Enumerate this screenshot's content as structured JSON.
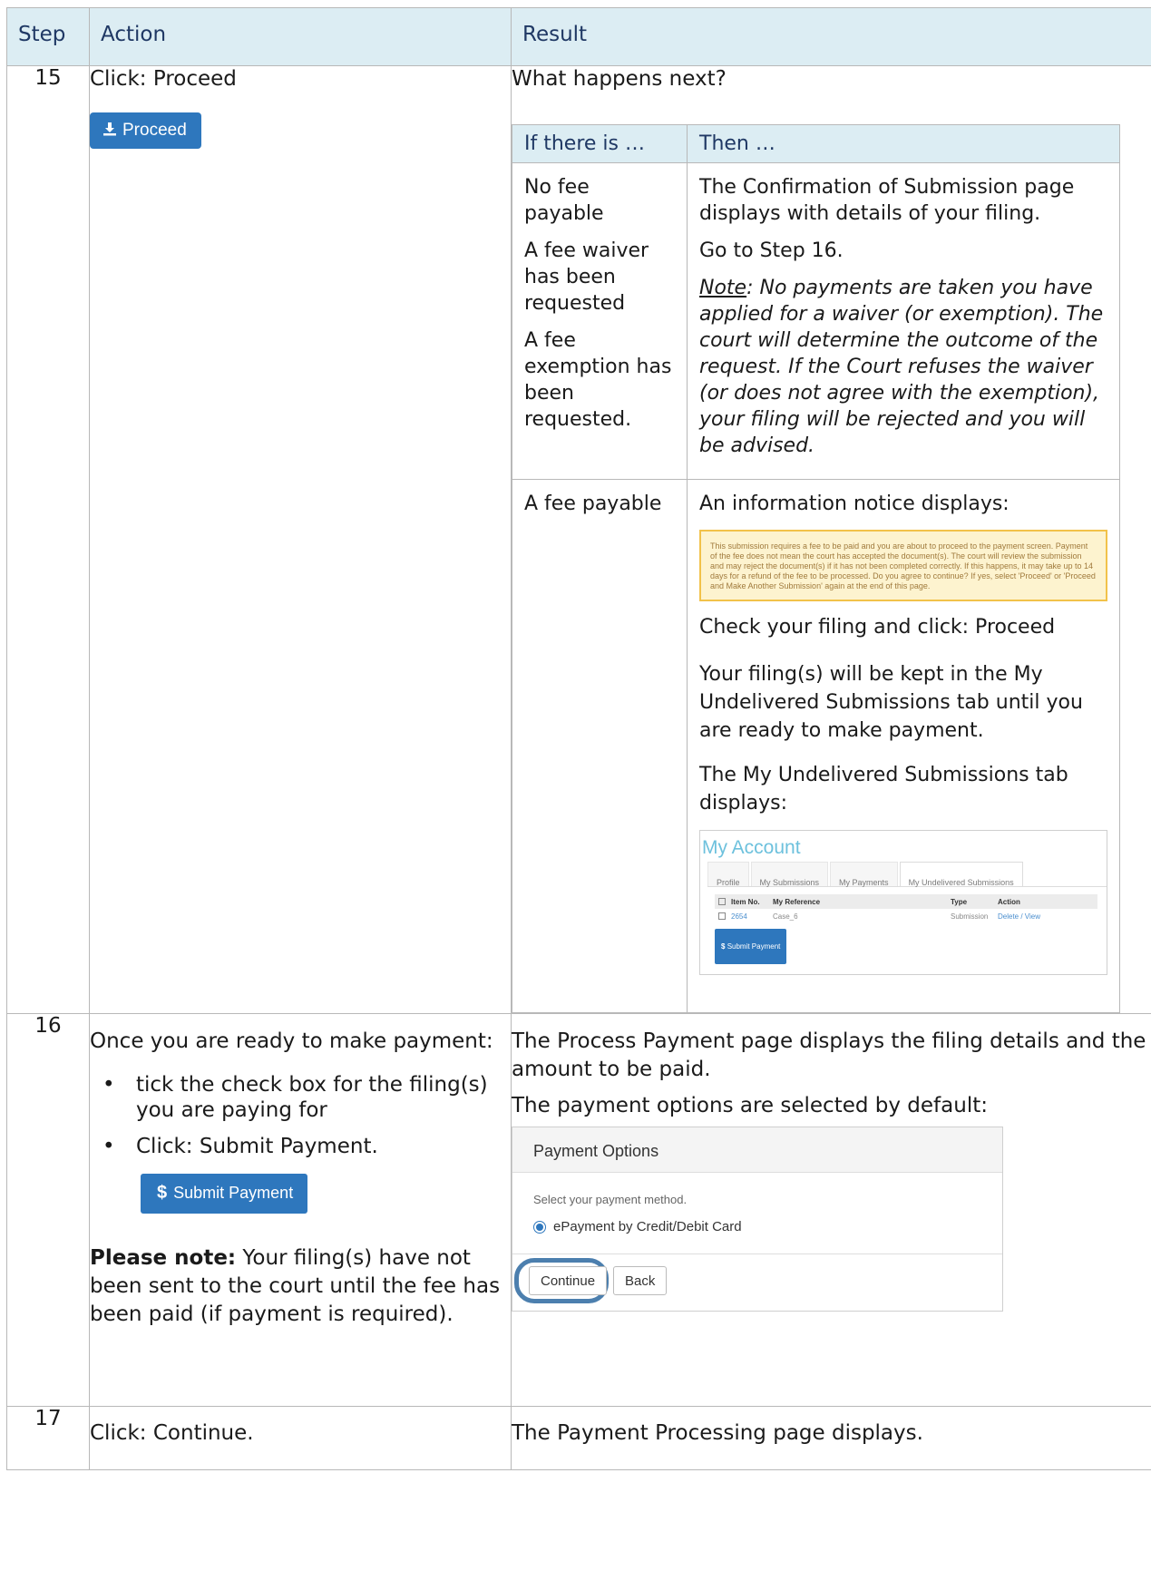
{
  "header": {
    "step": "Step",
    "action": "Action",
    "result": "Result"
  },
  "step15": {
    "number": "15",
    "action": "Click:  Proceed",
    "button_label": "Proceed",
    "result_intro": "What happens next?",
    "inner_header": {
      "col1": "If there is …",
      "col2": "Then …"
    },
    "row1": {
      "conditions": [
        "No fee payable",
        "A fee waiver has been requested",
        "A fee exemption has been requested."
      ],
      "text1": "The Confirmation of Submission page displays with details of your filing.",
      "text2": "Go to Step 16.",
      "note_label": "Note",
      "note_text": ":  No payments are taken you have applied for a waiver (or exemption).  The court will determine the outcome of the request. If the Court refuses the waiver (or does not agree with the exemption), your filing will be rejected and you will be advised."
    },
    "row2": {
      "condition": "A fee payable",
      "text1": "An information notice displays:",
      "notice": "This submission requires a fee to be paid and you are about to proceed to the payment screen. Payment of the fee does not mean the court has accepted the document(s). The court will review the submission and may reject the document(s) if it has not been completed correctly. If this happens, it may take up to 14 days for a refund of the fee to be processed. Do you agree to continue? If yes, select 'Proceed' or 'Proceed and Make Another Submission' again at the end of this page.",
      "text2": "Check your filing and click:  Proceed",
      "text3": "Your filing(s) will be kept in the My Undelivered Submissions tab until you are ready to make payment.",
      "text4": "The My Undelivered Submissions tab displays:",
      "account": {
        "title": "My Account",
        "tabs": [
          "Profile",
          "My Submissions",
          "My Payments",
          "My Undelivered Submissions"
        ],
        "columns": [
          "Item No.",
          "My Reference",
          "Type",
          "Action"
        ],
        "row": {
          "item": "2654",
          "reference": "Case_6",
          "type": "Submission",
          "action": "Delete / View"
        },
        "button": "Submit Payment"
      }
    }
  },
  "step16": {
    "number": "16",
    "intro": "Once you are ready to make payment:",
    "bullets": [
      "tick the check box for the filing(s) you are paying for",
      "Click: Submit Payment."
    ],
    "button_label": "Submit Payment",
    "note_bold": "Please note:",
    "note_text": " Your filing(s) have not been sent to the court until the fee has been paid (if payment is required).",
    "result1": "The Process Payment page displays the filing details and the amount to be paid.",
    "result2": "The payment options are selected by default:",
    "payment": {
      "title": "Payment Options",
      "prompt": "Select your payment method.",
      "option": "ePayment by Credit/Debit Card",
      "continue": "Continue",
      "back": "Back"
    }
  },
  "step17": {
    "number": "17",
    "action": "Click:  Continue.",
    "result": "The Payment Processing page displays."
  }
}
